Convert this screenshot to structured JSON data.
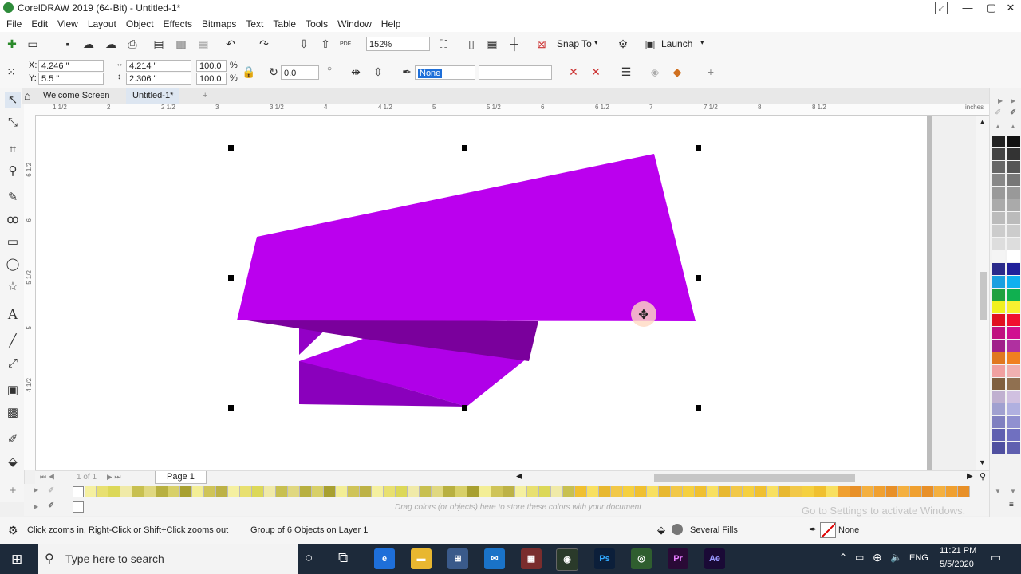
{
  "window": {
    "title": "CorelDRAW 2019 (64-Bit) - Untitled-1*",
    "controls": [
      "—",
      "▢",
      "✕"
    ]
  },
  "menu": [
    "File",
    "Edit",
    "View",
    "Layout",
    "Object",
    "Effects",
    "Bitmaps",
    "Text",
    "Table",
    "Tools",
    "Window",
    "Help"
  ],
  "toolbar": {
    "pdf_label": "PDF",
    "zoom_value": "152%",
    "snap_to": "Snap To",
    "launch": "Launch"
  },
  "properties": {
    "x": "4.246 \"",
    "y": "5.5 \"",
    "width": "4.214 \"",
    "height": "2.306 \"",
    "scale_w": "100.0",
    "scale_h": "100.0",
    "pct": "%",
    "rotation": "0.0",
    "outline_width": "None"
  },
  "tabs": {
    "welcome": "Welcome Screen",
    "doc": "Untitled-1*",
    "add": "+"
  },
  "ruler": {
    "units": "inches",
    "h_ticks": [
      "1 1/2",
      "2",
      "2 1/2",
      "3",
      "3 1/2",
      "4",
      "4 1/2",
      "5",
      "5 1/2",
      "6",
      "6 1/2",
      "7",
      "7 1/2",
      "8",
      "8 1/2"
    ],
    "v_ticks": [
      "6 1/2",
      "6",
      "5 1/2",
      "5",
      "4 1/2"
    ]
  },
  "page_nav": {
    "pager": "1 of 1",
    "page_tab": "Page 1"
  },
  "doc_palette": {
    "hint": "Drag colors (or objects) here to store these colors with your document"
  },
  "status": {
    "hint": "Click zooms in, Right-Click or Shift+Click zooms out",
    "selection": "Group of 6 Objects on Layer 1",
    "fill": "Several Fills",
    "outline": "None",
    "watermark": "Go to Settings to activate Windows."
  },
  "taskbar": {
    "search_placeholder": "Type here to search",
    "lang": "ENG",
    "time": "11:21 PM",
    "date": "5/5/2020"
  },
  "colors": {
    "ribbon_main": "#bb00ee",
    "ribbon_fold_dark": "#7a009c",
    "ribbon_mid": "#b000e8",
    "ribbon_tail": "#9300c6",
    "taskbar_bg": "#1d2a3a"
  }
}
